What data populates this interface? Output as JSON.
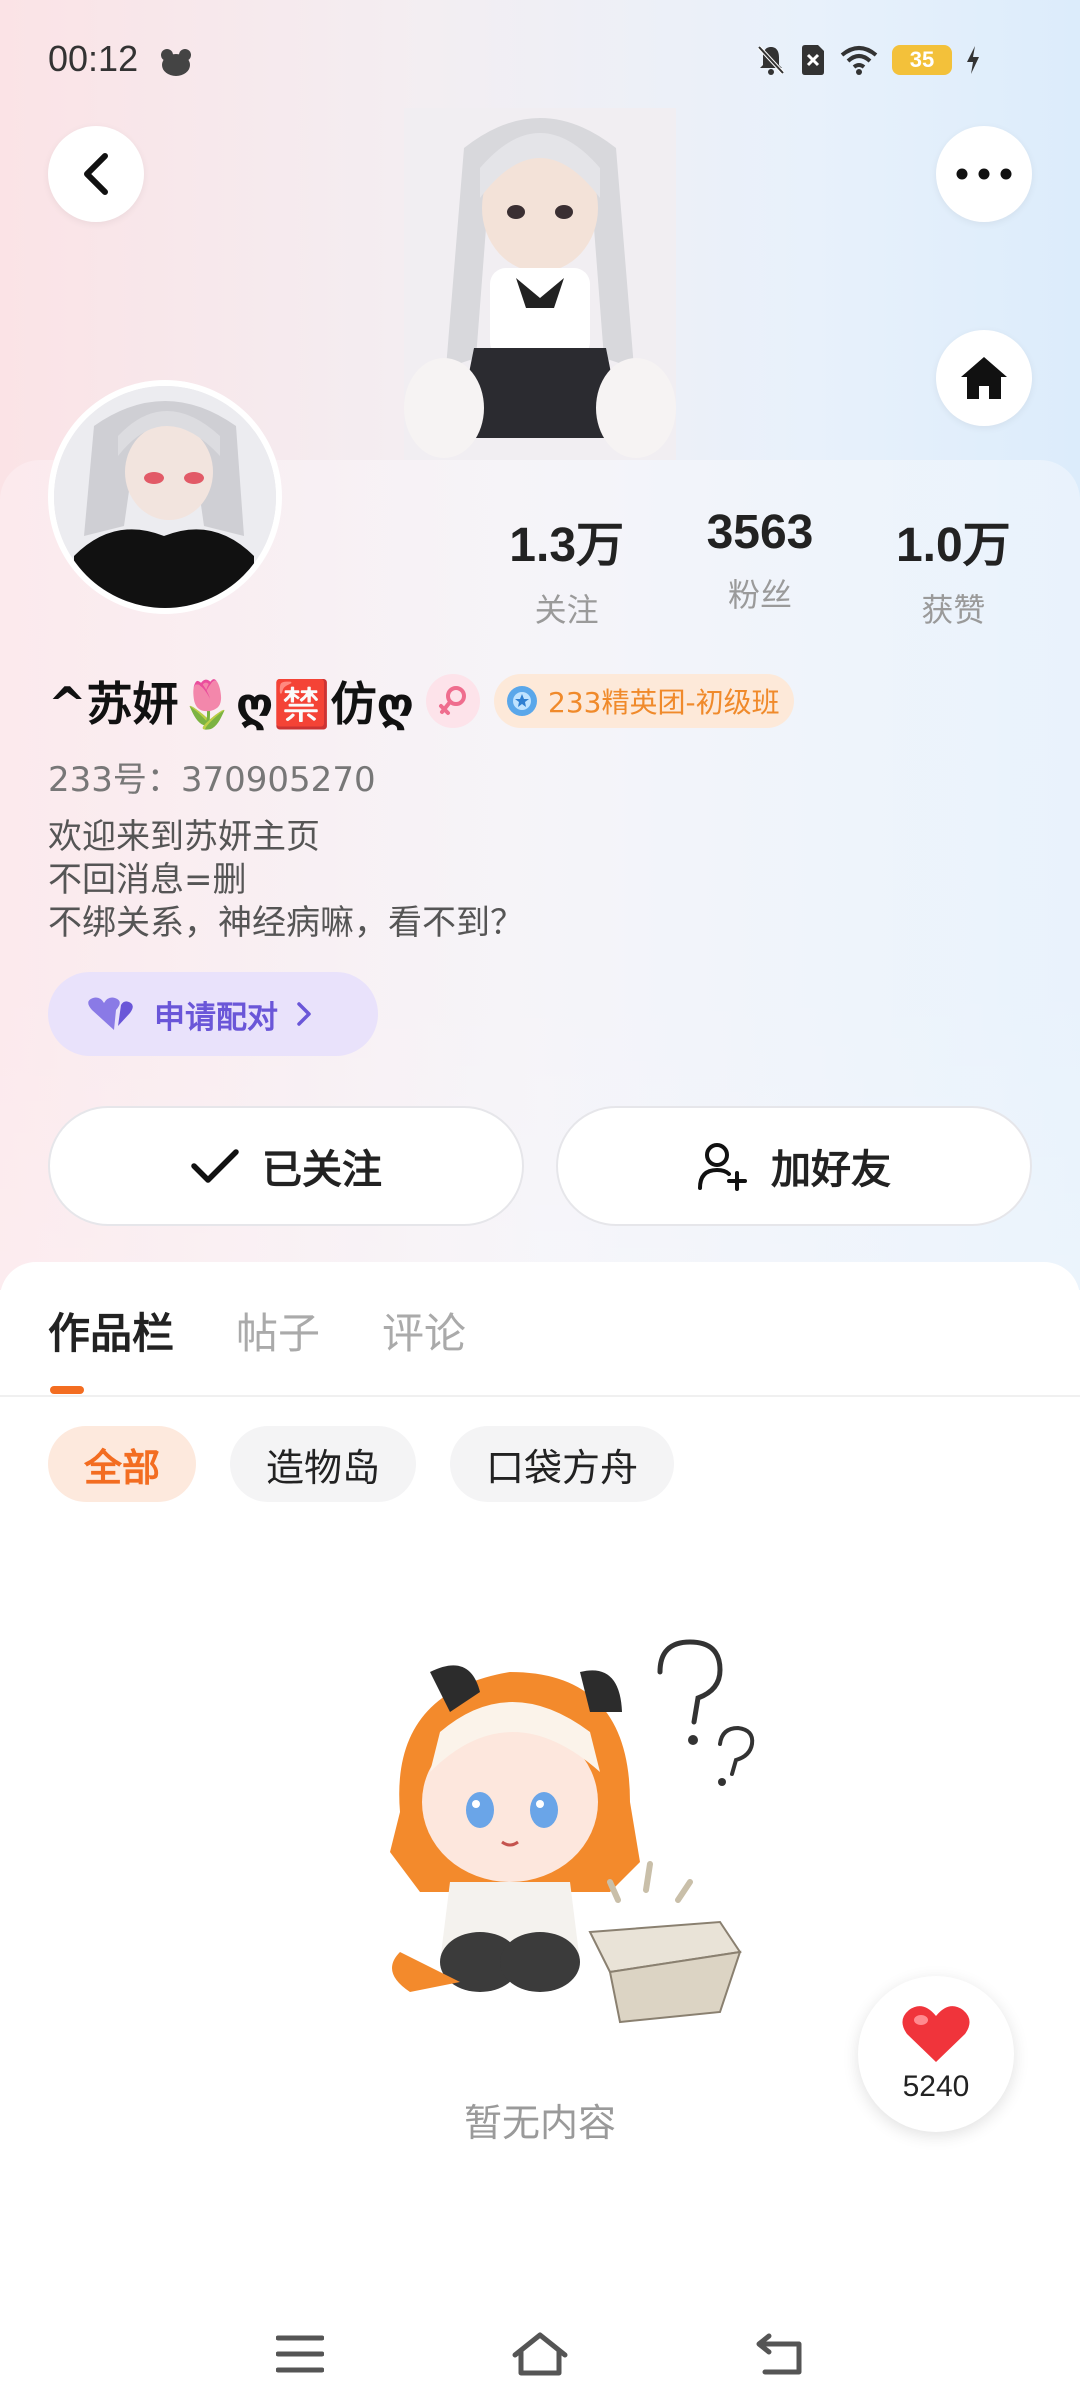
{
  "status_bar": {
    "time": "00:12",
    "battery": "35"
  },
  "profile": {
    "stats": [
      {
        "value": "1.3万",
        "label": "关注"
      },
      {
        "value": "3563",
        "label": "粉丝"
      },
      {
        "value": "1.0万",
        "label": "获赞"
      }
    ],
    "name": "^苏妍🌷ღ🈲仿ღ",
    "rank_badge": "233精英团-初级班",
    "uid": "233号：370905270",
    "bio": [
      "欢迎来到苏妍主页",
      "不回消息=删",
      "不绑关系，神经病嘛，看不到？"
    ],
    "pair_button": "申请配对",
    "follow_button": "已关注",
    "add_friend_button": "加好友"
  },
  "tabs": [
    "作品栏",
    "帖子",
    "评论"
  ],
  "chips": [
    "全部",
    "造物岛",
    "口袋方舟"
  ],
  "empty_text": "暂无内容",
  "like_count": "5240",
  "colors": {
    "accent": "#f36d21",
    "pair": "#6a56d8",
    "like": "#f0343b"
  }
}
